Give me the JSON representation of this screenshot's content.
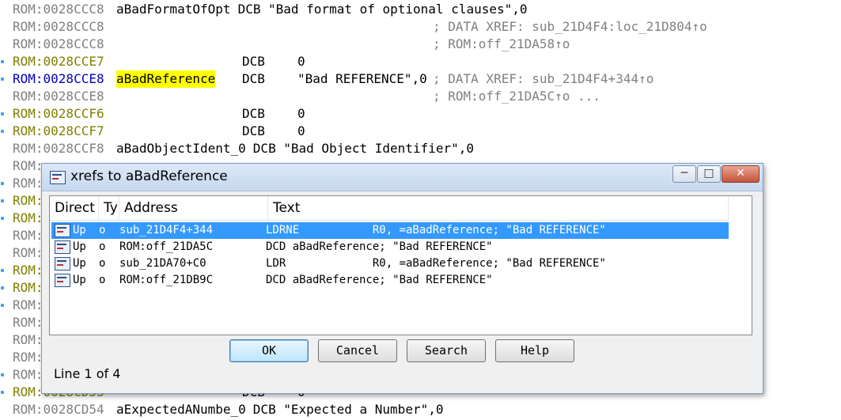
{
  "listing": [
    {
      "dot": false,
      "addr": "ROM:0028CCC8",
      "addr_color": "gray",
      "label": "aBadFormatOfOpt",
      "directive": "DCB",
      "operand": "\"Bad format of optional clauses\",0",
      "comment": ""
    },
    {
      "dot": false,
      "addr": "ROM:0028CCC8",
      "addr_color": "gray",
      "label": "",
      "directive": "",
      "operand": "",
      "comment": "; DATA XREF: sub_21D4F4:loc_21D804↑o"
    },
    {
      "dot": false,
      "addr": "ROM:0028CCC8",
      "addr_color": "gray",
      "label": "",
      "directive": "",
      "operand": "",
      "comment": "; ROM:off_21DA58↑o"
    },
    {
      "dot": true,
      "addr": "ROM:0028CCE7",
      "addr_color": "olive",
      "label": "",
      "directive": "DCB",
      "operand": "0",
      "comment": ""
    },
    {
      "dot": true,
      "addr": "ROM:0028CCE8",
      "addr_color": "blue",
      "label": "aBadReference",
      "label_highlight": true,
      "directive": "DCB",
      "operand": "\"Bad REFERENCE\",0",
      "comment": "; DATA XREF: sub_21D4F4+344↑o"
    },
    {
      "dot": false,
      "addr": "ROM:0028CCE8",
      "addr_color": "gray",
      "label": "",
      "directive": "",
      "operand": "",
      "comment": "; ROM:off_21DA5C↑o ..."
    },
    {
      "dot": true,
      "addr": "ROM:0028CCF6",
      "addr_color": "olive",
      "label": "",
      "directive": "DCB",
      "operand": "0",
      "comment": ""
    },
    {
      "dot": true,
      "addr": "ROM:0028CCF7",
      "addr_color": "olive",
      "label": "",
      "directive": "DCB",
      "operand": "0",
      "comment": ""
    },
    {
      "dot": false,
      "addr": "ROM:0028CCF8",
      "addr_color": "gray",
      "label": "aBadObjectIdent_0",
      "directive": "DCB",
      "operand": "\"Bad Object Identifier\",0",
      "comment": ""
    },
    {
      "dot": false,
      "addr": "ROM:",
      "addr_color": "gray",
      "label": "",
      "directive": "",
      "operand": "",
      "comment": ""
    },
    {
      "dot": true,
      "addr": "ROM:",
      "addr_color": "gray",
      "label": "",
      "directive": "",
      "operand": "",
      "comment": ""
    },
    {
      "dot": true,
      "addr": "ROM:",
      "addr_color": "olive",
      "label": "",
      "directive": "",
      "operand": "",
      "comment": ""
    },
    {
      "dot": true,
      "addr": "ROM:",
      "addr_color": "olive",
      "label": "",
      "directive": "",
      "operand": "",
      "comment": ""
    },
    {
      "dot": false,
      "addr": "ROM:",
      "addr_color": "gray",
      "label": "",
      "directive": "",
      "operand": "",
      "comment": ""
    },
    {
      "dot": false,
      "addr": "ROM:",
      "addr_color": "gray",
      "label": "",
      "directive": "",
      "operand": "",
      "comment": ""
    },
    {
      "dot": true,
      "addr": "ROM:",
      "addr_color": "olive",
      "label": "",
      "directive": "",
      "operand": "",
      "comment": ""
    },
    {
      "dot": true,
      "addr": "ROM:",
      "addr_color": "olive",
      "label": "",
      "directive": "",
      "operand": "",
      "comment": ""
    },
    {
      "dot": true,
      "addr": "ROM:",
      "addr_color": "gray",
      "label": "",
      "directive": "",
      "operand": "",
      "comment": ""
    },
    {
      "dot": false,
      "addr": "ROM:",
      "addr_color": "gray",
      "label": "",
      "directive": "",
      "operand": "",
      "comment": ""
    },
    {
      "dot": false,
      "addr": "ROM:",
      "addr_color": "gray",
      "label": "",
      "directive": "",
      "operand": "",
      "comment": ""
    },
    {
      "dot": false,
      "addr": "ROM:",
      "addr_color": "gray",
      "label": "",
      "directive": "",
      "operand": "",
      "comment": ""
    },
    {
      "dot": true,
      "addr": "ROM:",
      "addr_color": "gray",
      "label": "",
      "directive": "",
      "operand": "",
      "comment": ""
    },
    {
      "dot": true,
      "addr": "ROM:0028CD53",
      "addr_color": "olive",
      "label": "",
      "directive": "DCB",
      "operand": "0",
      "comment": ""
    },
    {
      "dot": false,
      "addr": "ROM:0028CD54",
      "addr_color": "gray",
      "label": "aExpectedANumbe_0",
      "directive": "DCB",
      "operand": "\"Expected a Number\",0",
      "comment": ""
    }
  ],
  "dialog": {
    "title": "xrefs to aBadReference",
    "window_buttons": {
      "minimize": "─",
      "maximize": "□",
      "close": "✕"
    },
    "columns": [
      "Direct",
      "Ty",
      "Address",
      "Text"
    ],
    "rows": [
      {
        "direction": "Up",
        "type": "o",
        "address": "sub_21D4F4+344",
        "text": "LDRNE           R0, =aBadReference; \"Bad REFERENCE\"",
        "selected": true
      },
      {
        "direction": "Up",
        "type": "o",
        "address": "ROM:off_21DA5C",
        "text": "DCD aBadReference; \"Bad REFERENCE\"",
        "selected": false
      },
      {
        "direction": "Up",
        "type": "o",
        "address": "sub_21DA70+C0",
        "text": "LDR             R0, =aBadReference; \"Bad REFERENCE\"",
        "selected": false
      },
      {
        "direction": "Up",
        "type": "o",
        "address": "ROM:off_21DB9C",
        "text": "DCD aBadReference; \"Bad REFERENCE\"",
        "selected": false
      }
    ],
    "buttons": {
      "ok": "OK",
      "cancel": "Cancel",
      "search": "Search",
      "help": "Help"
    },
    "status": "Line 1 of 4"
  },
  "colors": {
    "addr_gray": "#808080",
    "addr_olive": "#808000",
    "addr_blue": "#0000c0",
    "highlight": "#ffff00",
    "selection": "#3399ff",
    "bookmark_dot": "#3aa7e6"
  }
}
